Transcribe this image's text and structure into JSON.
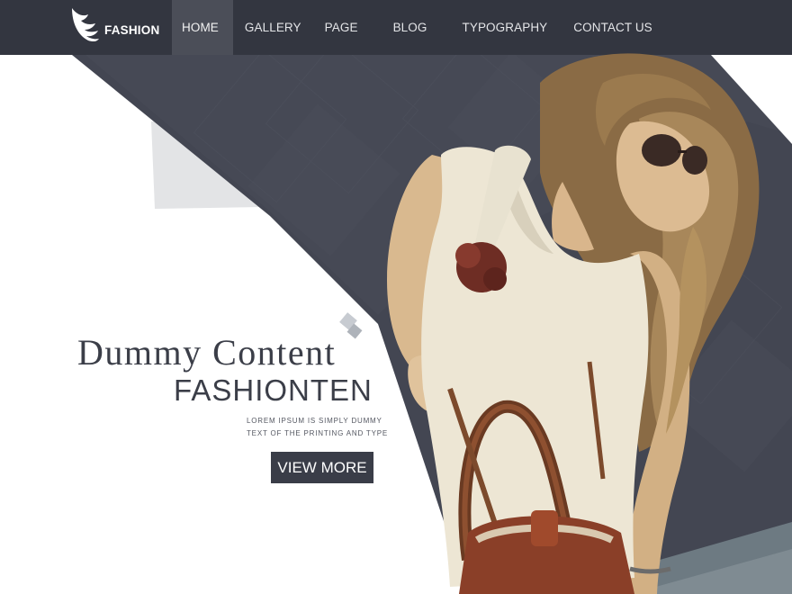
{
  "brand": {
    "name": "FASHION",
    "logo_icon": "wing-icon"
  },
  "nav": {
    "items": [
      {
        "label": "HOME",
        "active": true
      },
      {
        "label": "GALLERY",
        "active": false
      },
      {
        "label": "PAGE",
        "active": false
      },
      {
        "label": "BLOG",
        "active": false
      },
      {
        "label": "TYPOGRAPHY",
        "active": false
      },
      {
        "label": "CONTACT US",
        "active": false
      }
    ]
  },
  "hero": {
    "title": "Dummy Content",
    "subtitle": "FASHIONTEN",
    "desc_line1": "LOREM IPSUM IS SIMPLY DUMMY",
    "desc_line2": "TEXT OF THE PRINTING AND TYPE",
    "button_label": "VIEW MORE"
  },
  "colors": {
    "nav_bg": "#333640",
    "nav_active": "#4b4e58",
    "dark_panel": "#424550",
    "text_dark": "#3b3e48",
    "button_bg": "#3a3d48"
  }
}
